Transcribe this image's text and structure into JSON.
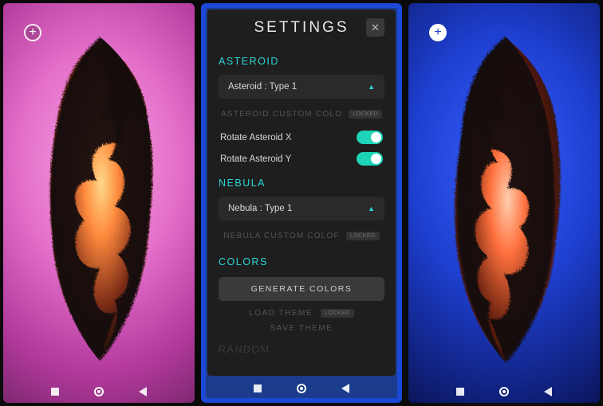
{
  "fab_icon": "+",
  "nav": {
    "buttons": [
      "recent",
      "home",
      "back"
    ]
  },
  "settings": {
    "title": "SETTINGS",
    "close_label": "✕",
    "asteroid": {
      "header": "ASTEROID",
      "dropdown_value": "Asteroid : Type 1",
      "custom_color_label": "ASTEROID CUSTOM COLO",
      "locked_badge": "LOCKED",
      "rotate_x_label": "Rotate Asteroid X",
      "rotate_x_on": true,
      "rotate_y_label": "Rotate Asteroid Y",
      "rotate_y_on": true
    },
    "nebula": {
      "header": "NEBULA",
      "dropdown_value": "Nebula : Type 1",
      "custom_color_label": "NEBULA CUSTOM COLOF",
      "locked_badge": "LOCKED"
    },
    "colors": {
      "header": "COLORS",
      "generate_label": "GENERATE COLORS",
      "load_theme_label": "LOAD THEME",
      "load_theme_locked": "LOCKED",
      "save_theme_label": "SAVE THEME"
    },
    "random": {
      "header": "RANDOM"
    }
  }
}
